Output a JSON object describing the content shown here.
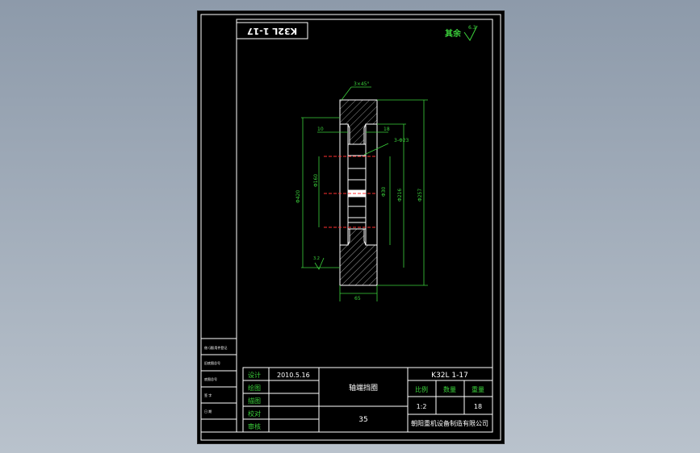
{
  "drawing_number": "K32L 1-17",
  "drawing_number_mirrored": "K32L 1-17",
  "surface_finish": {
    "label": "其余",
    "value": "6.3"
  },
  "part_name": "轴端挡圈",
  "material": "35",
  "company": "朝阳重机设备制造有限公司",
  "title_block": {
    "rows": [
      {
        "label": "设计",
        "value": "2010.5.16"
      },
      {
        "label": "绘图",
        "value": ""
      },
      {
        "label": "描图",
        "value": ""
      },
      {
        "label": "校对",
        "value": ""
      },
      {
        "label": "审核",
        "value": ""
      }
    ],
    "headers": [
      "比例",
      "数量",
      "重量"
    ],
    "values": [
      "1:2",
      "",
      "18"
    ]
  },
  "side_block": [
    "借 (通)用件登记",
    "旧底图总号",
    "底图总号",
    "签 字",
    "日 期"
  ],
  "dimensions": {
    "chamfer": "3×45°",
    "left_offset": "10",
    "right_offset": "18",
    "holes": "3-Φ23",
    "bolt_circle": "Φ160",
    "inner_dia": "Φ420",
    "bore": "Φ30",
    "outer_dia": "Φ216",
    "total_dia": "Φ257",
    "thickness": "65",
    "roughness_small": "3.2",
    "roughness_label": "6.3"
  },
  "colors": {
    "line": "#ffffff",
    "dim": "#3bd13b",
    "center": "#ff3030"
  }
}
